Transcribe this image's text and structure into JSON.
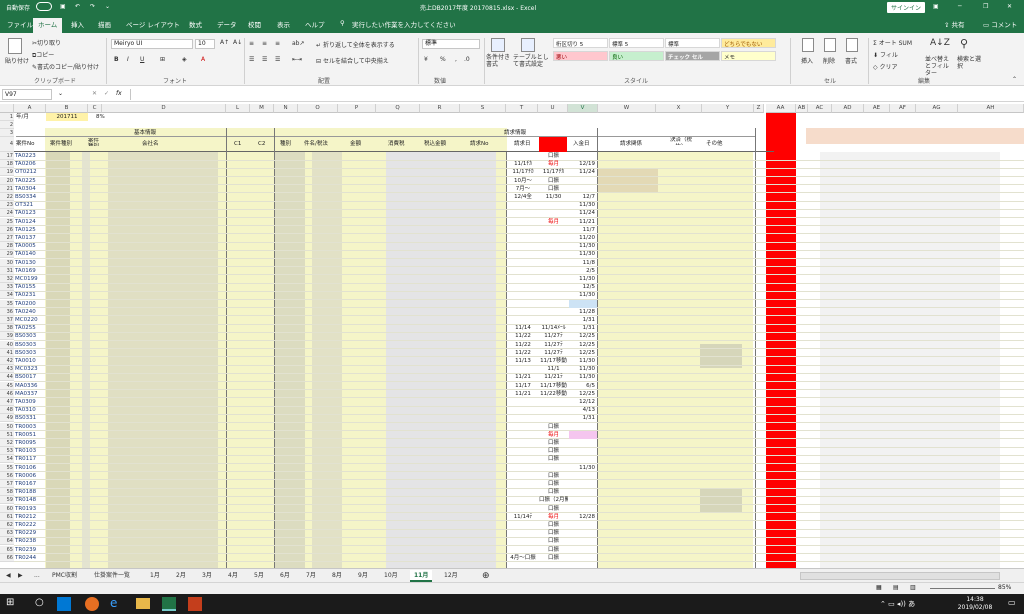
{
  "window": {
    "autosave": "自動保存",
    "title": "売上DB2017年度 20170815.xlsx - Excel",
    "signin": "サインイン"
  },
  "tabs": [
    "ファイル",
    "ホーム",
    "挿入",
    "描画",
    "ページ レイアウト",
    "数式",
    "データ",
    "校閲",
    "表示",
    "ヘルプ"
  ],
  "tell_me": "実行したい作業を入力してください",
  "share": "共有",
  "comments": "コメント",
  "clipboard": {
    "paste": "貼り付け",
    "cut": "切り取り",
    "copy": "コピー",
    "format_painter": "書式のコピー/貼り付け",
    "group": "クリップボード"
  },
  "font": {
    "name": "Meiryo UI",
    "size": "10",
    "group": "フォント",
    "bold": "B",
    "italic": "I",
    "underline": "U"
  },
  "alignment": {
    "wrap": "折り返して全体を表示する",
    "merge": "セルを結合して中央揃え",
    "group": "配置"
  },
  "number": {
    "format": "標準",
    "group": "数値"
  },
  "styles": {
    "cond": "条件付き書式",
    "table": "テーブルとして書式設定",
    "s1": "桁区切り 5",
    "s2": "標準 5",
    "s3": "標準",
    "s4": "どちらでもない",
    "s5": "悪い",
    "s6": "良い",
    "s7": "チェック セル",
    "s8": "メモ",
    "group": "スタイル"
  },
  "cells": {
    "insert": "挿入",
    "delete": "削除",
    "format": "書式",
    "group": "セル"
  },
  "editing": {
    "autosum": "オート SUM",
    "fill": "フィル",
    "clear": "クリア",
    "sort": "並べ替えとフィルター",
    "find": "検索と選択",
    "group": "編集"
  },
  "namebox": "V97",
  "fx": "fx",
  "columns": [
    "A",
    "B",
    "C",
    "D",
    "L",
    "M",
    "N",
    "O",
    "P",
    "Q",
    "R",
    "S",
    "T",
    "U",
    "V",
    "W",
    "X",
    "Y",
    "Z",
    "AA",
    "AB",
    "AC",
    "AD",
    "AE",
    "AF",
    "AG",
    "AH"
  ],
  "sheet": {
    "r1": {
      "label": "年/月",
      "value": "201711",
      "rate": "8%"
    },
    "section1": "基本情報",
    "section2": "請求情報",
    "headers": {
      "a": "案件No",
      "b": "案件種別",
      "c": "案件 種別",
      "d": "会社名",
      "l": "C1",
      "m": "C2",
      "n": "種別",
      "o": "件名/税法",
      "p": "金額",
      "q": "消費税",
      "r": "税込金額",
      "s": "請求No",
      "t": "請求日",
      "v": "入金日",
      "w": "請求関係",
      "x": "決済（税抜）",
      "y": "その他"
    }
  },
  "rows": [
    {
      "n": "17",
      "a": "TA0223",
      "t": "",
      "u": "口振",
      "v": ""
    },
    {
      "n": "18",
      "a": "TA0206",
      "t": "11/1ﾁｶ",
      "u": "毎月",
      "v": "12/19"
    },
    {
      "n": "19",
      "a": "OT0212",
      "t": "11/17ﾁｶ",
      "u": "11/17ﾁｶ",
      "v": "11/24"
    },
    {
      "n": "20",
      "a": "TA0225",
      "t": "10月～",
      "u": "口振",
      "v": ""
    },
    {
      "n": "21",
      "a": "TA0304",
      "t": "7月～",
      "u": "口振",
      "v": ""
    },
    {
      "n": "22",
      "a": "BS0334",
      "t": "12/4全",
      "u": "11/30",
      "v": "12/7"
    },
    {
      "n": "23",
      "a": "OT321",
      "t": "",
      "u": "",
      "v": "11/30"
    },
    {
      "n": "24",
      "a": "TA0123",
      "t": "",
      "u": "",
      "v": "11/24"
    },
    {
      "n": "25",
      "a": "TA0124",
      "t": "",
      "u": "毎月",
      "v": "11/21"
    },
    {
      "n": "26",
      "a": "TA0125",
      "t": "",
      "u": "",
      "v": "11/7"
    },
    {
      "n": "27",
      "a": "TA0137",
      "t": "",
      "u": "",
      "v": "11/20"
    },
    {
      "n": "28",
      "a": "TA0005",
      "t": "",
      "u": "",
      "v": "11/30"
    },
    {
      "n": "29",
      "a": "TA0140",
      "t": "",
      "u": "",
      "v": "11/30"
    },
    {
      "n": "30",
      "a": "TA0130",
      "t": "",
      "u": "",
      "v": "11/8"
    },
    {
      "n": "31",
      "a": "TA0169",
      "t": "",
      "u": "",
      "v": "2/5"
    },
    {
      "n": "32",
      "a": "MC0199",
      "t": "",
      "u": "",
      "v": "11/30"
    },
    {
      "n": "33",
      "a": "TA0155",
      "t": "",
      "u": "",
      "v": "12/5"
    },
    {
      "n": "34",
      "a": "TA0231",
      "t": "",
      "u": "",
      "v": "11/30"
    },
    {
      "n": "35",
      "a": "TA0200",
      "t": "",
      "u": "",
      "v": ""
    },
    {
      "n": "36",
      "a": "TA0240",
      "t": "",
      "u": "",
      "v": "11/28"
    },
    {
      "n": "37",
      "a": "MC0220",
      "t": "",
      "u": "",
      "v": "1/31"
    },
    {
      "n": "38",
      "a": "TA0255",
      "t": "11/14",
      "u": "11/14ﾒｰﾙ",
      "v": "1/31"
    },
    {
      "n": "39",
      "a": "BS0303",
      "t": "11/22",
      "u": "11/27ﾃ",
      "v": "12/25"
    },
    {
      "n": "40",
      "a": "BS0303",
      "t": "11/22",
      "u": "11/27ﾃ",
      "v": "12/25"
    },
    {
      "n": "41",
      "a": "BS0303",
      "t": "11/22",
      "u": "11/27ﾃ",
      "v": "12/25"
    },
    {
      "n": "42",
      "a": "TA0010",
      "t": "11/13",
      "u": "11/17移動",
      "v": "11/30"
    },
    {
      "n": "43",
      "a": "MC0323",
      "t": "",
      "u": "11/1",
      "v": "11/30"
    },
    {
      "n": "44",
      "a": "BS0017",
      "t": "11/21",
      "u": "11/21ﾃ",
      "v": "11/30"
    },
    {
      "n": "45",
      "a": "MA0336",
      "t": "11/17",
      "u": "11/17移動",
      "v": "6/5"
    },
    {
      "n": "46",
      "a": "MA0337",
      "t": "11/21",
      "u": "11/22移動",
      "v": "12/25"
    },
    {
      "n": "47",
      "a": "TA0309",
      "t": "",
      "u": "",
      "v": "12/12"
    },
    {
      "n": "48",
      "a": "TA0310",
      "t": "",
      "u": "",
      "v": "4/13"
    },
    {
      "n": "49",
      "a": "BS0331",
      "t": "",
      "u": "",
      "v": "1/31"
    },
    {
      "n": "50",
      "a": "TR0003",
      "t": "",
      "u": "口振",
      "v": ""
    },
    {
      "n": "51",
      "a": "TR0051",
      "t": "",
      "u": "毎月",
      "v": ""
    },
    {
      "n": "52",
      "a": "TR0095",
      "t": "",
      "u": "口振",
      "v": ""
    },
    {
      "n": "53",
      "a": "TR0103",
      "t": "",
      "u": "口振",
      "v": ""
    },
    {
      "n": "54",
      "a": "TR0117",
      "t": "",
      "u": "口振",
      "v": ""
    },
    {
      "n": "55",
      "a": "TR0106",
      "t": "",
      "u": "",
      "v": "11/30"
    },
    {
      "n": "56",
      "a": "TR0006",
      "t": "",
      "u": "口振",
      "v": ""
    },
    {
      "n": "57",
      "a": "TR0167",
      "t": "",
      "u": "口振",
      "v": ""
    },
    {
      "n": "58",
      "a": "TR0188",
      "t": "",
      "u": "口振",
      "v": ""
    },
    {
      "n": "59",
      "a": "TR0148",
      "t": "",
      "u": "口振（2月開始）",
      "v": ""
    },
    {
      "n": "60",
      "a": "TR0193",
      "t": "",
      "u": "口振",
      "v": ""
    },
    {
      "n": "61",
      "a": "TR0212",
      "t": "11/14ﾃ",
      "u": "毎月",
      "v": "12/28"
    },
    {
      "n": "62",
      "a": "TR0222",
      "t": "",
      "u": "口振",
      "v": ""
    },
    {
      "n": "63",
      "a": "TR0229",
      "t": "",
      "u": "口振",
      "v": ""
    },
    {
      "n": "64",
      "a": "TR0238",
      "t": "",
      "u": "口振",
      "v": ""
    },
    {
      "n": "65",
      "a": "TR0239",
      "t": "",
      "u": "口振",
      "v": ""
    },
    {
      "n": "66",
      "a": "TR0244",
      "t": "4月～口振",
      "u": "口振",
      "v": ""
    }
  ],
  "sheet_tabs": [
    "...",
    "PMC収割",
    "仕掛案件一覧",
    "1月",
    "2月",
    "3月",
    "4月",
    "5月",
    "6月",
    "7月",
    "8月",
    "9月",
    "10月",
    "11月",
    "12月"
  ],
  "active_sheet": "11月",
  "zoom": "85%",
  "clock": {
    "time": "14:38",
    "date": "2019/02/08"
  },
  "colors": {
    "excel_green": "#217346",
    "red_col": "#ff0000",
    "pale_yellow": "#f5f5c8"
  }
}
